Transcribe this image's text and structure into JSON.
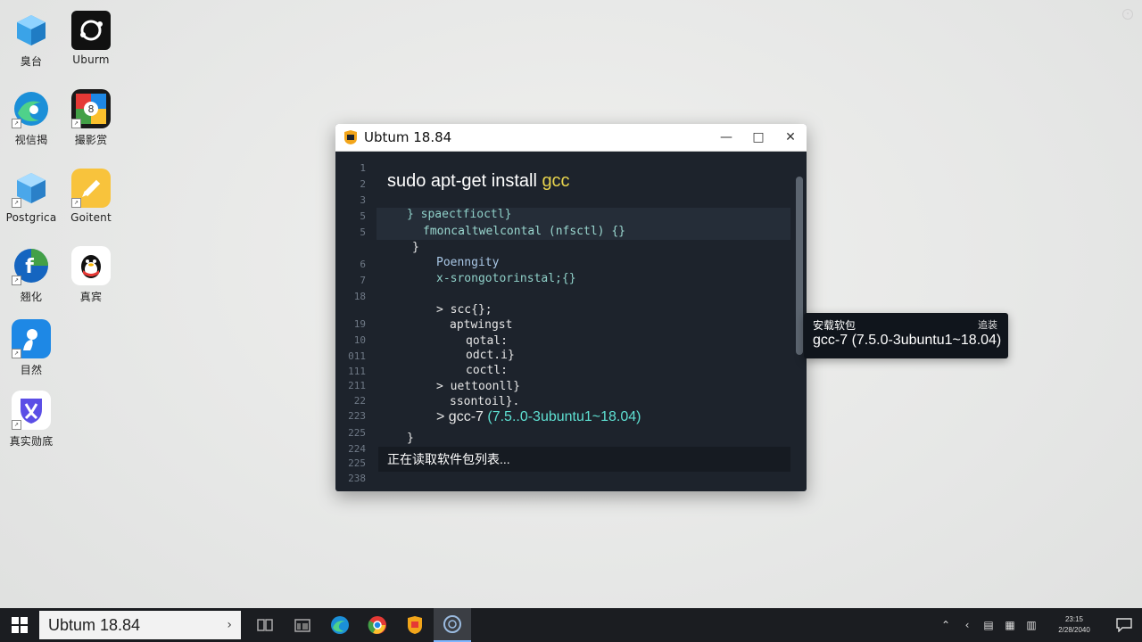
{
  "desktop": {
    "icons": [
      {
        "label": "臭台"
      },
      {
        "label": "Uburm"
      },
      {
        "label": "视信揭"
      },
      {
        "label": "撮影赏"
      },
      {
        "label": "Postgrica"
      },
      {
        "label": "Goitent"
      },
      {
        "label": "翘化"
      },
      {
        "label": "真宾"
      },
      {
        "label": "目然"
      },
      {
        "label": "真实勋底"
      }
    ]
  },
  "window": {
    "title": "Ubtum 18.84",
    "controls": {
      "minimize": "—",
      "maximize": "□",
      "close": "✕"
    },
    "line_numbers": [
      "1",
      "2",
      "3",
      "5",
      "5",
      "6",
      "7",
      "18",
      "19",
      "10",
      "011",
      "111",
      "211",
      "22",
      "223",
      "225",
      "224",
      "225",
      "238"
    ],
    "command": {
      "text": "sudo apt-get install ",
      "keyword": "gcc"
    },
    "lines": [
      "}   spaectfioctl}",
      "fmoncaltwelcontal (nfsctl) {}",
      "}",
      "Poenngity",
      "x-srongotorinstal;{}",
      "> scc{};",
      "aptwingst",
      "qotal:",
      "odct.i}",
      "coctl:",
      "> uettoonll}",
      "ssontoil}.",
      "> gcc-7",
      "}"
    ],
    "gcc_version": " (7.5..0-3ubuntu1~18.04)",
    "status": "正在读取软件包列表..."
  },
  "tooltip": {
    "title": "安载软包",
    "action": "追装",
    "package": "gcc-7 (7.5.0-3ubuntu1~18.04)"
  },
  "taskbar": {
    "search_text": "Ubtum 18.84",
    "search_arrow": "›",
    "clock_time": "23:15",
    "clock_date": "2/28/2040"
  },
  "colors": {
    "terminal_bg": "#1d232c",
    "keyword": "#e8d44d",
    "teal_text": "#5ee0d2",
    "comment_text": "#8fd0c8"
  }
}
